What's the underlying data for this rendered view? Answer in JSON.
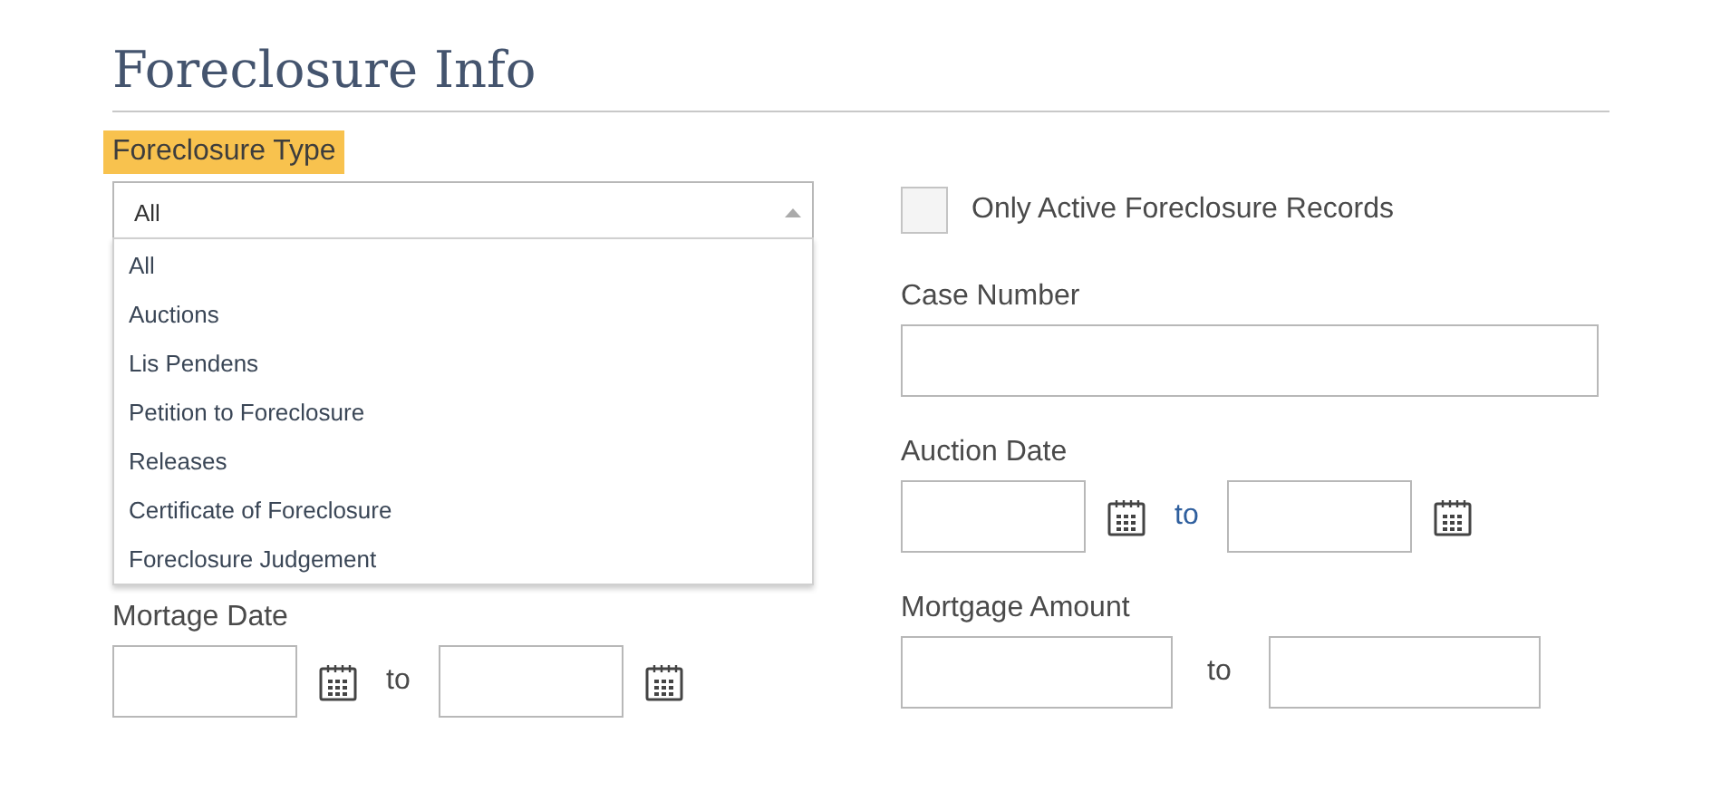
{
  "heading": "Foreclosure Info",
  "foreclosure_type": {
    "label": "Foreclosure Type",
    "value": "All",
    "expanded": true,
    "options": [
      "All",
      "Auctions",
      "Lis Pendens",
      "Petition to Foreclosure",
      "Releases",
      "Certificate of Foreclosure",
      "Foreclosure Judgement"
    ]
  },
  "mortgage_date": {
    "label": "Mortage Date",
    "separator": "to"
  },
  "active_only": {
    "label": "Only Active Foreclosure Records",
    "checked": false
  },
  "case_number": {
    "label": "Case Number"
  },
  "auction_date": {
    "label": "Auction Date",
    "separator": "to"
  },
  "mortgage_amount": {
    "label": "Mortgage Amount",
    "separator": "to"
  }
}
